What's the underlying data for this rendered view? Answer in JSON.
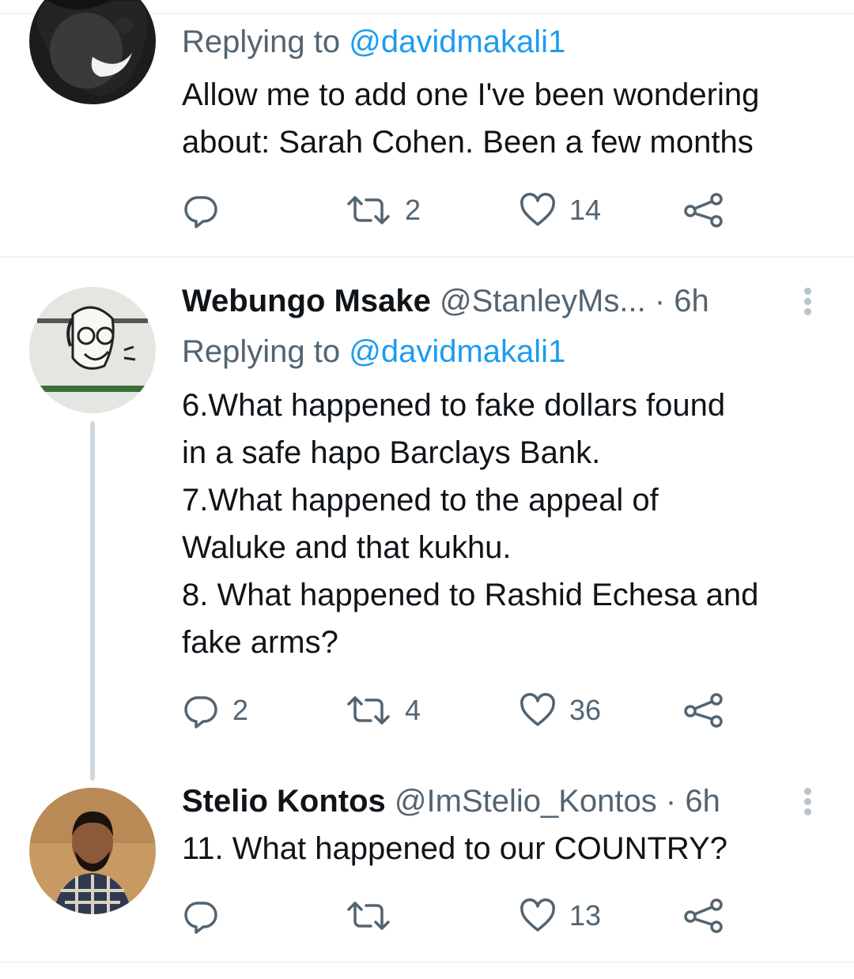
{
  "tweets": [
    {
      "replying_label": "Replying to",
      "replying_to": "@davidmakali1",
      "lines": [
        "Allow me to add one I've been wondering",
        "about: Sarah Cohen. Been a few months"
      ],
      "actions": {
        "reply": "",
        "retweet": "2",
        "like": "14"
      }
    },
    {
      "name": "Webungo Msake",
      "handle": "@StanleyMs...",
      "time": "· 6h",
      "replying_label": "Replying to",
      "replying_to": "@davidmakali1",
      "lines": [
        "6.What happened to fake dollars found",
        "in a safe hapo Barclays Bank.",
        "7.What happened to the appeal of",
        "Waluke and that kukhu.",
        "8. What happened to Rashid Echesa and",
        "fake arms?"
      ],
      "actions": {
        "reply": "2",
        "retweet": "4",
        "like": "36"
      }
    },
    {
      "name": "Stelio Kontos",
      "handle": "@ImStelio_Kontos",
      "time": "· 6h",
      "lines": [
        "11. What happened to our COUNTRY?"
      ],
      "actions": {
        "reply": "",
        "retweet": "",
        "like": "13"
      }
    }
  ],
  "colors": {
    "text": "#0f1419",
    "secondary": "#536471",
    "link": "#1d9bf0",
    "divider": "#eff3f4"
  },
  "icons": [
    "reply-icon",
    "retweet-icon",
    "like-icon",
    "share-icon",
    "more-icon"
  ]
}
